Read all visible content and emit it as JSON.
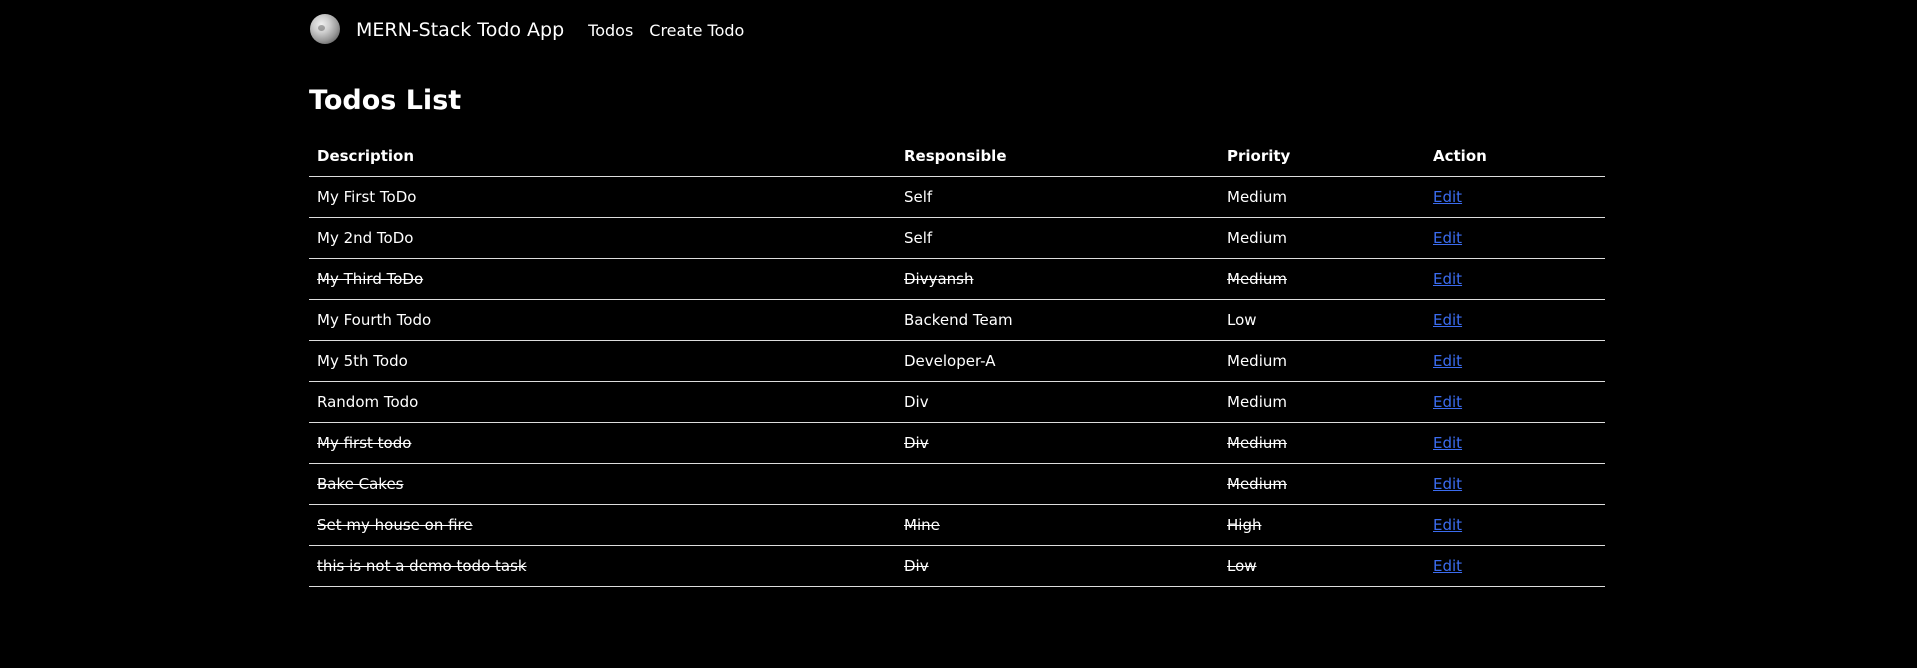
{
  "navbar": {
    "logo_icon": "moon-logo-icon",
    "brand": "MERN-Stack Todo App",
    "links": [
      "Todos",
      "Create Todo"
    ]
  },
  "page": {
    "title": "Todos List"
  },
  "table": {
    "headers": [
      "Description",
      "Responsible",
      "Priority",
      "Action"
    ],
    "rows": [
      {
        "description": "My First ToDo",
        "responsible": "Self",
        "priority": "Medium",
        "action": "Edit",
        "completed": false
      },
      {
        "description": "My 2nd ToDo",
        "responsible": "Self",
        "priority": "Medium",
        "action": "Edit",
        "completed": false
      },
      {
        "description": "My Third ToDo",
        "responsible": "Divyansh",
        "priority": "Medium",
        "action": "Edit",
        "completed": true
      },
      {
        "description": "My Fourth Todo",
        "responsible": "Backend Team",
        "priority": "Low",
        "action": "Edit",
        "completed": false
      },
      {
        "description": "My 5th Todo",
        "responsible": "Developer-A",
        "priority": "Medium",
        "action": "Edit",
        "completed": false
      },
      {
        "description": "Random Todo",
        "responsible": "Div",
        "priority": "Medium",
        "action": "Edit",
        "completed": false
      },
      {
        "description": "My first todo",
        "responsible": "Div",
        "priority": "Medium",
        "action": "Edit",
        "completed": true
      },
      {
        "description": "Bake Cakes",
        "responsible": "",
        "priority": "Medium",
        "action": "Edit",
        "completed": true
      },
      {
        "description": "Set my house on fire",
        "responsible": "Mine",
        "priority": "High",
        "action": "Edit",
        "completed": true
      },
      {
        "description": "this is not a demo todo task",
        "responsible": "Div",
        "priority": "Low",
        "action": "Edit",
        "completed": true
      }
    ]
  },
  "colors": {
    "background": "#000000",
    "text": "#ffffff",
    "link": "#3b6cf0",
    "border": "#dddddd"
  }
}
